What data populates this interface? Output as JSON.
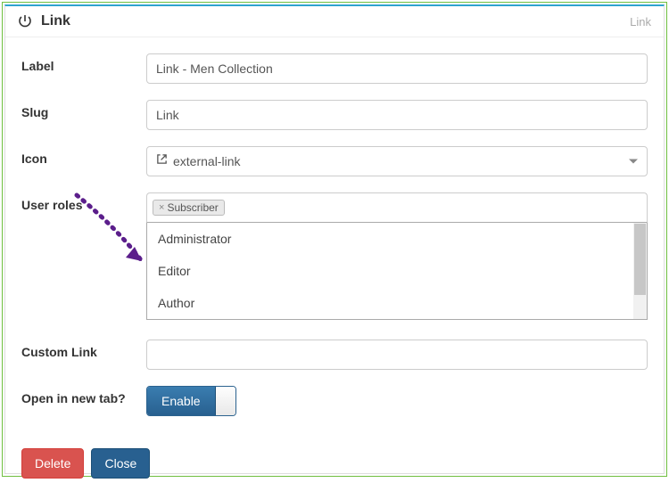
{
  "header": {
    "title": "Link",
    "subtitle": "Link"
  },
  "fields": {
    "label": {
      "caption": "Label",
      "value": "Link - Men Collection"
    },
    "slug": {
      "caption": "Slug",
      "value": "Link"
    },
    "icon": {
      "caption": "Icon",
      "value": "external-link"
    },
    "userRoles": {
      "caption": "User roles",
      "tags": [
        "Subscriber"
      ],
      "options": [
        "Administrator",
        "Editor",
        "Author"
      ]
    },
    "customLink": {
      "caption": "Custom Link",
      "value": ""
    },
    "newTab": {
      "caption": "Open in new tab?",
      "toggleLabel": "Enable"
    }
  },
  "footer": {
    "delete": "Delete",
    "close": "Close"
  }
}
